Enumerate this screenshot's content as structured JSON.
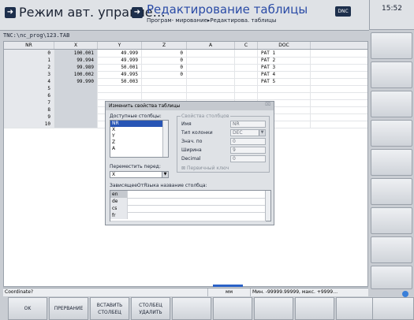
{
  "header": {
    "mode_title": "Режим авт. управле…",
    "prog_title": "Редактирование таблицы",
    "breadcrumb": "Програм- мирование▸Редактирова. таблицы",
    "dnc_badge": "DNC",
    "clock": "15:52"
  },
  "path": "TNC:\\nc_prog\\123.TAB",
  "table": {
    "columns": [
      "NR",
      "X",
      "Y",
      "Z",
      "A",
      "C",
      "DOC"
    ],
    "rows": [
      {
        "nr": "0",
        "x": "100.001",
        "y": "49.999",
        "z": "0",
        "a": "",
        "c": "",
        "doc": "PAT 1"
      },
      {
        "nr": "1",
        "x": "99.994",
        "y": "49.999",
        "z": "0",
        "a": "",
        "c": "",
        "doc": "PAT 2"
      },
      {
        "nr": "2",
        "x": "99.989",
        "y": "50.001",
        "z": "0",
        "a": "",
        "c": "",
        "doc": "PAT 3"
      },
      {
        "nr": "3",
        "x": "100.002",
        "y": "49.995",
        "z": "0",
        "a": "",
        "c": "",
        "doc": "PAT 4"
      },
      {
        "nr": "4",
        "x": "99.990",
        "y": "50.003",
        "z": "",
        "a": "",
        "c": "",
        "doc": "PAT 5"
      },
      {
        "nr": "5",
        "x": "",
        "y": "",
        "z": "",
        "a": "",
        "c": "",
        "doc": ""
      },
      {
        "nr": "6",
        "x": "",
        "y": "",
        "z": "",
        "a": "",
        "c": "",
        "doc": ""
      },
      {
        "nr": "7",
        "x": "",
        "y": "",
        "z": "",
        "a": "",
        "c": "",
        "doc": ""
      },
      {
        "nr": "8",
        "x": "",
        "y": "",
        "z": "",
        "a": "",
        "c": "",
        "doc": ""
      },
      {
        "nr": "9",
        "x": "",
        "y": "",
        "z": "",
        "a": "",
        "c": "",
        "doc": ""
      },
      {
        "nr": "10",
        "x": "",
        "y": "",
        "z": "",
        "a": "",
        "c": "",
        "doc": ""
      }
    ]
  },
  "dialog": {
    "title": "Изменить свойства таблицы",
    "close": "⌧",
    "available_label": "Доступные столбцы:",
    "available_columns": [
      "NR",
      "X",
      "Y",
      "Z",
      "A"
    ],
    "move_label": "Переместить перед:",
    "move_value": "X",
    "props_legend": "Свойства столбцов",
    "props": {
      "name_label": "Имя",
      "name_value": "NR",
      "type_label": "Тип колонки",
      "type_value": "DEC",
      "default_label": "Знач. по",
      "default_value": "0",
      "width_label": "Ширина",
      "width_value": "9",
      "decimal_label": "Decimal",
      "decimal_value": "0",
      "pk_label": "Первичный ключ"
    },
    "lang_label": "ЗависящееОтЯзыка название столбца:",
    "langs": [
      "en",
      "de",
      "cs",
      "fr"
    ]
  },
  "status": {
    "left": "Coordinate?",
    "unit": "мм",
    "range": "Мин. -99999.99999, макс. +9999…"
  },
  "softkeys": {
    "ok": "OK",
    "abort": "ПРЕРВАНИЕ",
    "insert_top": "ВСТАВИТЬ",
    "insert_bottom": "СТОЛБЕЦ",
    "delete_top": "СТОЛБЕЦ",
    "delete_bottom": "УДАЛИТЬ"
  },
  "colors": {
    "accent": "#2a4ba6",
    "selection": "#2855b5"
  }
}
